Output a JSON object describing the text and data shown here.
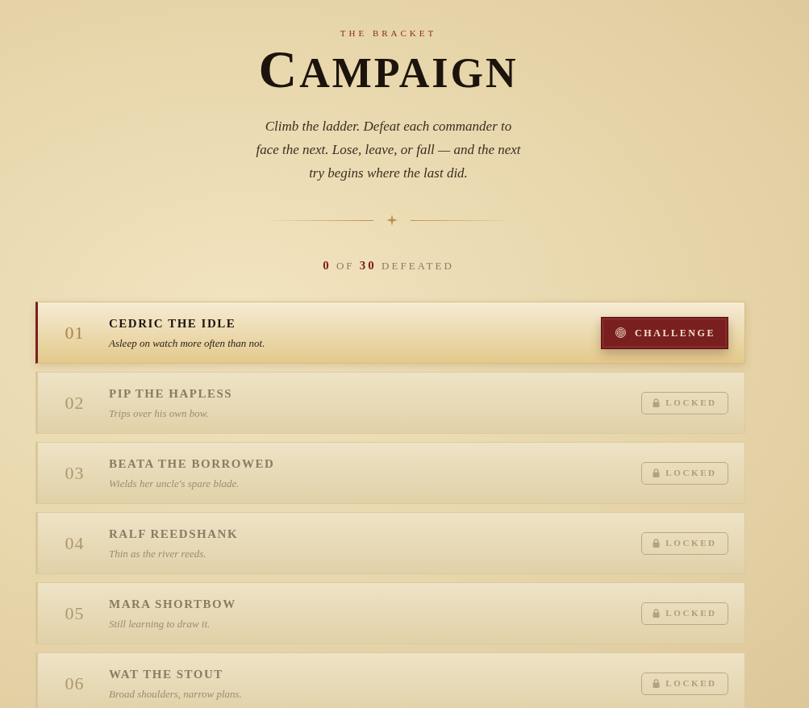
{
  "header": {
    "eyebrow": "THE BRACKET",
    "title": "CAMPAIGN",
    "intro": "Climb the ladder. Defeat each commander to face the next. Lose, leave, or fall — and the next try begins where the last did."
  },
  "progress": "**0** OF **30** DEFEATED",
  "commanders": [
    {
      "number": "01",
      "name": "CEDRIC THE IDLE",
      "description": "Asleep on watch more often than not.",
      "kind": "available",
      "action": "CHALLENGE"
    },
    {
      "number": "02",
      "name": "PIP THE HAPLESS",
      "description": "Trips over his own bow.",
      "kind": "locked",
      "action": "LOCKED"
    },
    {
      "number": "03",
      "name": "BEATA THE BORROWED",
      "description": "Wields her uncle's spare blade.",
      "kind": "locked",
      "action": "LOCKED"
    },
    {
      "number": "04",
      "name": "RALF REEDSHANK",
      "description": "Thin as the river reeds.",
      "kind": "locked",
      "action": "LOCKED"
    },
    {
      "number": "05",
      "name": "MARA SHORTBOW",
      "description": "Still learning to draw it.",
      "kind": "locked",
      "action": "LOCKED"
    },
    {
      "number": "06",
      "name": "WAT THE STOUT",
      "description": "Broad shoulders, narrow plans.",
      "kind": "locked",
      "action": "LOCKED"
    }
  ]
}
